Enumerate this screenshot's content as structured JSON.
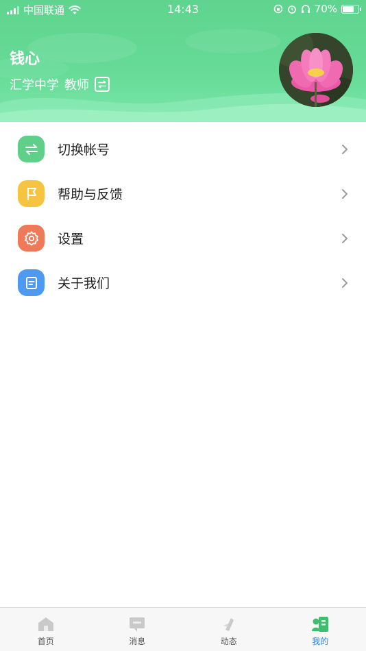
{
  "status_bar": {
    "carrier": "中国联通",
    "time": "14:43",
    "battery": "70%",
    "battery_level": 0.7
  },
  "profile": {
    "name": "钱心",
    "school": "汇学中学",
    "role": "教师"
  },
  "menu": {
    "items": [
      {
        "label": "切换帐号",
        "icon": "switch-account-icon",
        "color": "#5fcf8a"
      },
      {
        "label": "帮助与反馈",
        "icon": "flag-icon",
        "color": "#f5c542"
      },
      {
        "label": "设置",
        "icon": "gear-icon",
        "color": "#ef7a5a"
      },
      {
        "label": "关于我们",
        "icon": "document-icon",
        "color": "#4d9af0"
      }
    ]
  },
  "tabbar": {
    "items": [
      {
        "label": "首页",
        "icon": "home-icon"
      },
      {
        "label": "消息",
        "icon": "message-icon"
      },
      {
        "label": "动态",
        "icon": "feed-icon"
      },
      {
        "label": "我的",
        "icon": "profile-icon",
        "active": true
      }
    ]
  },
  "colors": {
    "header_green": "#66db97",
    "active_tab": "#2f7de1"
  }
}
